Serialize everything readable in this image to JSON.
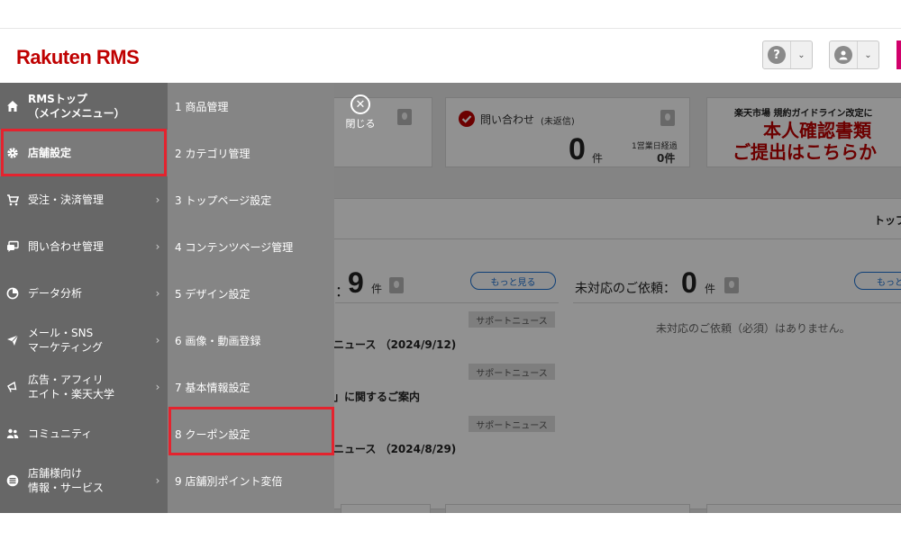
{
  "header": {
    "logo": "Rakuten RMS",
    "help_icon_glyph": "?",
    "chevron_glyph": "⌄"
  },
  "left_menu": {
    "items": [
      {
        "label_line1": "RMSトップ",
        "label_line2": "（メインメニュー）",
        "icon": "home-icon"
      },
      {
        "label_line1": "店舗設定",
        "label_line2": "",
        "icon": "gear-icon"
      },
      {
        "label_line1": "受注・決済管理",
        "label_line2": "",
        "icon": "cart-icon"
      },
      {
        "label_line1": "問い合わせ管理",
        "label_line2": "",
        "icon": "chat-icon"
      },
      {
        "label_line1": "データ分析",
        "label_line2": "",
        "icon": "pie-chart-icon"
      },
      {
        "label_line1": "メール・SNS",
        "label_line2": "マーケティング",
        "icon": "paper-plane-icon"
      },
      {
        "label_line1": "広告・アフィリ",
        "label_line2": "エイト・楽天大学",
        "icon": "megaphone-icon"
      },
      {
        "label_line1": "コミュニティ",
        "label_line2": "",
        "icon": "community-icon"
      },
      {
        "label_line1": "店舗様向け",
        "label_line2": "情報・サービス",
        "icon": "list-icon"
      }
    ],
    "arrow_glyph": "›"
  },
  "sub_menu": {
    "items": [
      "1 商品管理",
      "2 カテゴリ管理",
      "3 トップページ設定",
      "4 コンテンツページ管理",
      "5 デザイン設定",
      "6 画像・動画登録",
      "7 基本情報設定",
      "8 クーポン設定",
      "9 店舗別ポイント変倍"
    ]
  },
  "close": {
    "glyph": "✕",
    "label": "閉じる"
  },
  "inquiry_card": {
    "title": "問い合わせ",
    "title_note": "(未返信)",
    "count": "0",
    "unit": "件",
    "sub_label": "1営業日経過",
    "sub_value": "0件"
  },
  "banner": {
    "line1": "楽天市場 規約ガイドライン改定に",
    "line2": "本人確認書類",
    "line3": "ご提出はこちらか"
  },
  "section": {
    "right_label": "トップ"
  },
  "news_panel": {
    "count_prefix": "：",
    "count": "9",
    "unit": "件",
    "more_label": "もっと見る",
    "items": [
      {
        "tag": "サポートニュース",
        "title": "ニュース （2024/9/12)"
      },
      {
        "tag": "サポートニュース",
        "title": "」に関するご案内"
      },
      {
        "tag": "サポートニュース",
        "title": "ニュース （2024/8/29)"
      }
    ]
  },
  "request_panel": {
    "label": "未対応のご依頼：",
    "count": "0",
    "unit": "件",
    "more_label": "もっと",
    "empty_message": "未対応のご依頼（必須）はありません。"
  },
  "colors": {
    "brand_red": "#bf0000",
    "highlight_red": "#e4232e",
    "link_blue": "#1a6fd1"
  }
}
